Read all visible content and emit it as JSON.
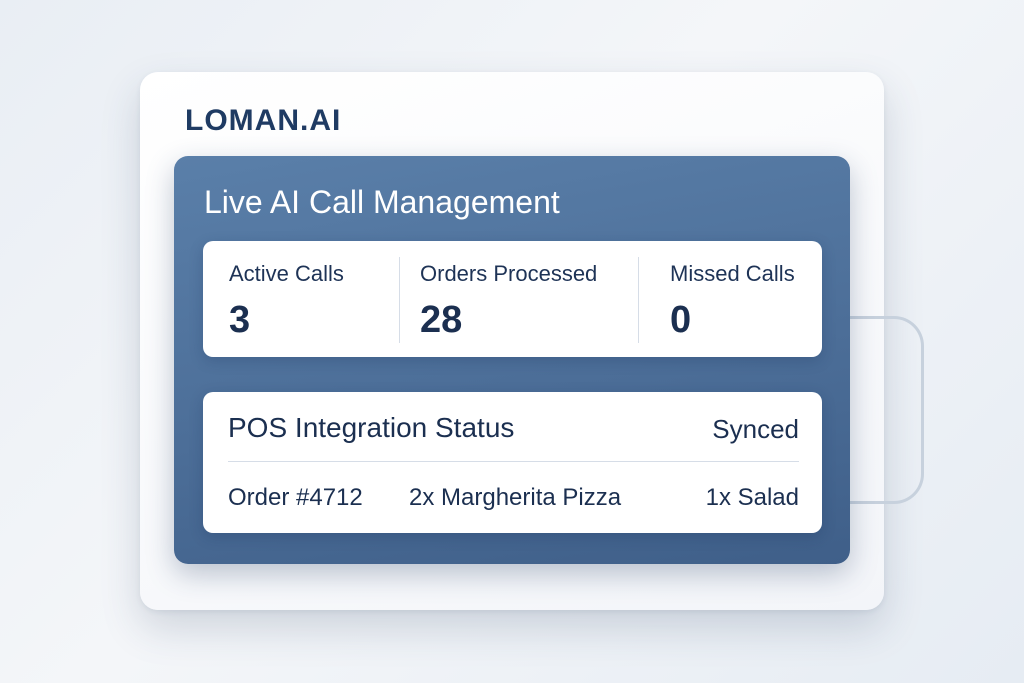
{
  "brand": {
    "name": "LOMAN.AI"
  },
  "panel": {
    "title": "Live AI Call Management"
  },
  "metrics": [
    {
      "label": "Active Calls",
      "value": "3"
    },
    {
      "label": "Orders Processed",
      "value": "28"
    },
    {
      "label": "Missed Calls",
      "value": "0"
    }
  ],
  "pos": {
    "title": "POS Integration Status",
    "status": "Synced",
    "order": {
      "id": "Order #4712",
      "item_1": "2x Margherita Pizza",
      "item_2": "1x Salad"
    }
  },
  "colors": {
    "brand": "#1f3b63",
    "panel_blue": "#4c6e98",
    "text_dark": "#1b2f50"
  }
}
